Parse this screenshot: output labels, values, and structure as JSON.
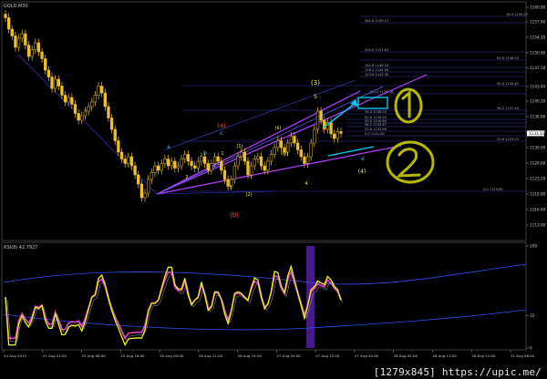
{
  "chart_data": [
    {
      "type": "candlestick",
      "symbol": "GOLD,M30",
      "ylim": [
        1110.8,
        1160.8
      ],
      "yticks": [
        1160.8,
        1157.6,
        1154.2,
        1150.8,
        1147.5,
        1143.4,
        1140.2,
        1136.8,
        1133.4,
        1130.0,
        1126.6,
        1123.2,
        1119.8,
        1116.4,
        1113.0
      ],
      "current_price": 1133.11,
      "xticks": [
        "24 Aug 2015",
        "25 Aug 01:00",
        "25 Aug 08:00",
        "25 Aug 16:00",
        "26 Aug 00:00",
        "26 Aug 11:00",
        "26 Aug 19:30",
        "27 Aug 04:00",
        "27 Aug 12:00",
        "27 Aug 20:00",
        "28 Aug 05:00",
        "28 Aug 13:00",
        "28 Aug 21:00",
        "31 Aug 06:00"
      ],
      "close": [
        1158.5,
        1156.0,
        1154.5,
        1152.0,
        1154.0,
        1155.0,
        1152.5,
        1150.0,
        1151.5,
        1153.0,
        1151.0,
        1149.5,
        1147.0,
        1145.5,
        1143.0,
        1145.0,
        1143.5,
        1141.5,
        1140.0,
        1141.0,
        1139.5,
        1137.5,
        1136.0,
        1137.0,
        1138.0,
        1139.0,
        1140.0,
        1141.5,
        1143.5,
        1142.0,
        1139.0,
        1136.5,
        1134.0,
        1131.5,
        1129.0,
        1127.5,
        1126.5,
        1128.0,
        1126.0,
        1124.0,
        1122.0,
        1119.0,
        1120.0,
        1123.0,
        1124.5,
        1126.0,
        1125.0,
        1126.5,
        1127.5,
        1126.0,
        1127.0,
        1125.5,
        1126.0,
        1127.5,
        1128.5,
        1127.0,
        1126.0,
        1125.5,
        1127.0,
        1128.0,
        1126.5,
        1125.0,
        1126.5,
        1128.0,
        1127.0,
        1125.0,
        1123.0,
        1121.5,
        1123.0,
        1126.0,
        1128.0,
        1129.0,
        1127.0,
        1124.0,
        1126.0,
        1127.5,
        1128.0,
        1126.0,
        1125.0,
        1127.0,
        1128.5,
        1130.0,
        1131.5,
        1130.0,
        1129.0,
        1131.0,
        1132.5,
        1131.0,
        1129.5,
        1128.0,
        1126.5,
        1128.0,
        1131.0,
        1134.0,
        1138.0,
        1136.0,
        1134.0,
        1135.5,
        1133.0,
        1132.0,
        1133.5,
        1133.1
      ],
      "fib_levels": [
        {
          "pct": "76.4",
          "price": "1159.27"
        },
        {
          "pct": "261.8",
          "price": "1159.27"
        },
        {
          "pct": "200.0",
          "price": "1151.63"
        },
        {
          "pct": "61.8",
          "price": "1148.55"
        },
        {
          "pct": "161.8",
          "price": "1146.53"
        },
        {
          "pct": "138.2",
          "price": "1144.63"
        },
        {
          "pct": "123.6",
          "price": "1143.30"
        },
        {
          "pct": "50.0",
          "price": "1140.81"
        },
        {
          "pct": "100.0",
          "price": "1138.58"
        },
        {
          "pct": "38.2",
          "price": "1137.40"
        },
        {
          "pct": "76.4",
          "price": "1136.55"
        },
        {
          "pct": "61.8",
          "price": "1135.45"
        },
        {
          "pct": "50.0",
          "price": "1134.64"
        },
        {
          "pct": "38.2",
          "price": "1133.87"
        },
        {
          "pct": "23.6",
          "price": "1132.66"
        },
        {
          "pct": "0.0",
          "price": "1131.00"
        },
        {
          "pct": "23.6",
          "price": "1129.25"
        },
        {
          "pct": "0.0",
          "price": "1119.80"
        }
      ],
      "wave_labels": [
        "(a)",
        "(b)",
        "(3)",
        "(4)",
        "(ii)",
        "(iv)",
        "(1)",
        "(2)",
        "a",
        "b",
        "c",
        "d",
        "e",
        "1",
        "2",
        "3",
        "4",
        "5"
      ],
      "annotations": [
        "1",
        "2"
      ],
      "colors": {
        "up": "#f0c028",
        "down": "#f0c028",
        "text": "#c8c8c8",
        "grid": "#3a3a4a",
        "guide": "#b040ff",
        "annotation": "#b8b800",
        "box": "#00c8f0"
      }
    },
    {
      "type": "line",
      "title": "RSI(8) 42.7927",
      "ylim": [
        0,
        100
      ],
      "yticks": [
        "100",
        "32",
        "0"
      ],
      "series": [
        {
          "name": "RSI(8)",
          "color": "#f0f020"
        }
      ]
    }
  ],
  "watermark": "[1279x845] https://upic.me/"
}
